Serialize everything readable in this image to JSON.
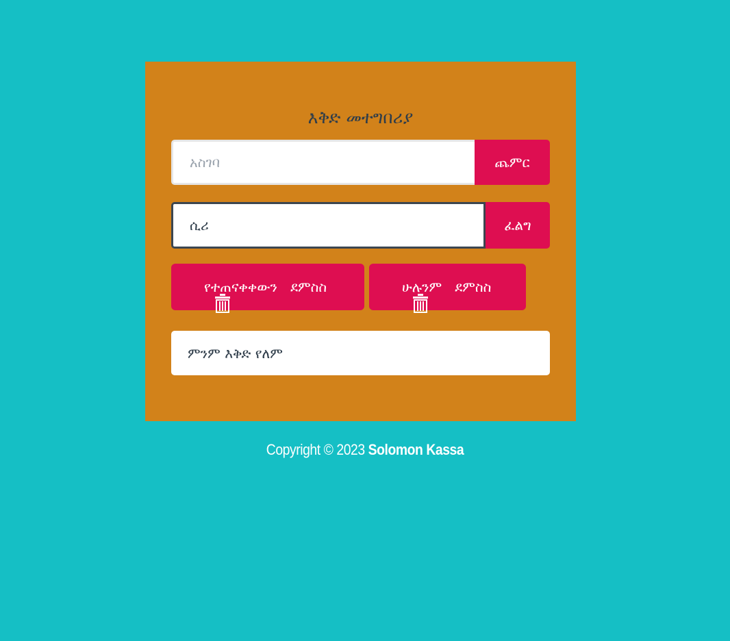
{
  "app": {
    "title": "እቅድ መተግበሪያ"
  },
  "add_form": {
    "input_placeholder": "አስገባ",
    "input_value": "",
    "button_label": "ጨምር"
  },
  "search_form": {
    "input_value": "ሲሪ",
    "button_label": "ፈልግ"
  },
  "actions": {
    "clear_completed_label": "የተጠናቀቀውን   ደምስስ",
    "clear_all_label": "ሁሉንም   ደምስስ"
  },
  "list": {
    "empty_message": "ምንም እቅድ የለም"
  },
  "footer": {
    "copyright": "Copyright © 2023 ",
    "author": "Solomon Kassa"
  },
  "colors": {
    "background": "#15bfc5",
    "card": "#d2821a",
    "accent": "#de0e51",
    "text": "#2f3d4a"
  },
  "icons": {
    "trash": "trash-icon"
  }
}
